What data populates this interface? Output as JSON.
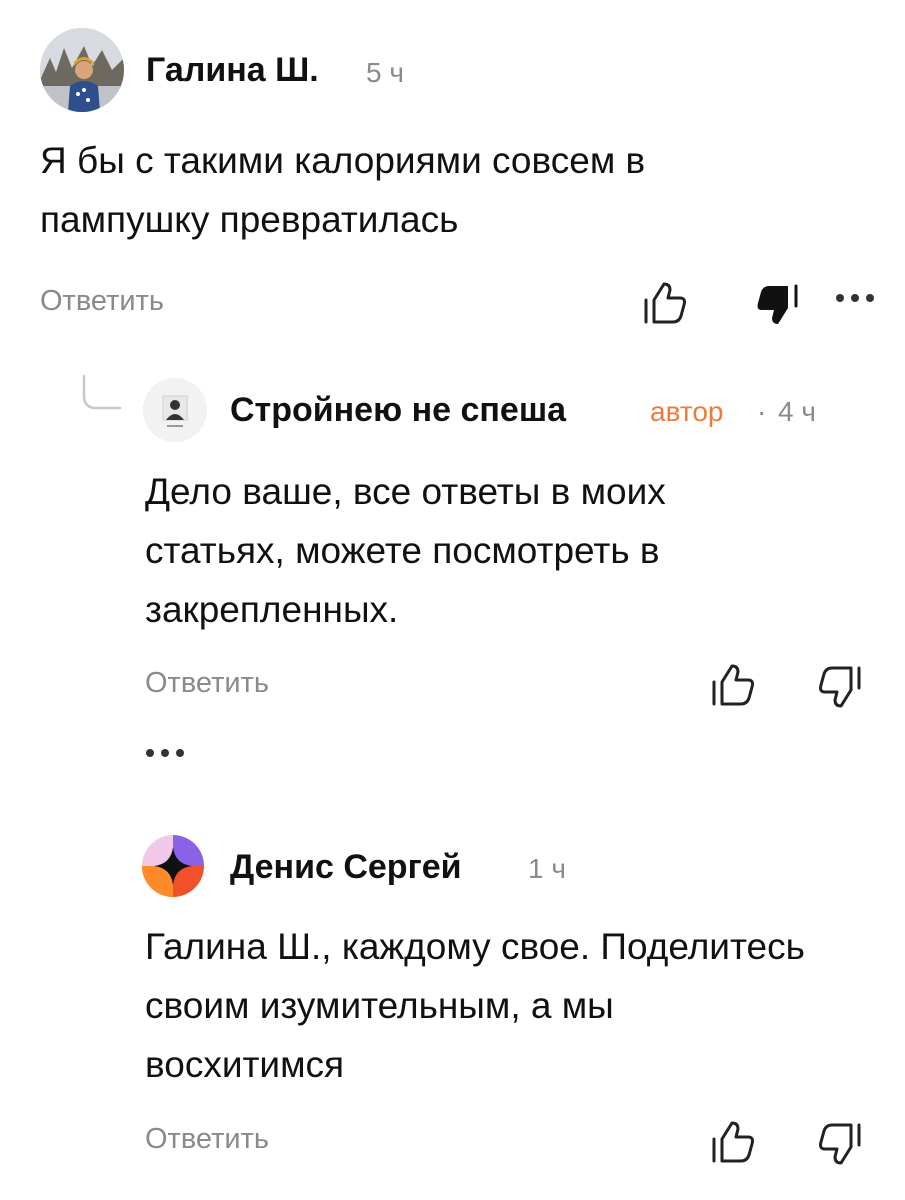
{
  "comments": [
    {
      "author": "Галина Ш.",
      "time": "5 ч",
      "text_lines": [
        "Я бы с такими калориями совсем в",
        "пампушку превратилась"
      ],
      "reply_label": "Ответить"
    },
    {
      "author": "Стройнею не спеша",
      "author_badge": "автор",
      "separator": "·",
      "time": "4 ч",
      "text_lines": [
        "Дело ваше, все ответы в моих",
        "статьях, можете посмотреть в",
        "закрепленных."
      ],
      "reply_label": "Ответить"
    },
    {
      "author": "Денис Сергей",
      "time": "1 ч",
      "text_lines": [
        "Галина Ш., каждому свое. Поделитесь",
        "своим изумительным, а мы",
        "восхитимся"
      ],
      "reply_label": "Ответить"
    }
  ],
  "icons": {
    "like": "thumbs-up-icon",
    "dislike": "thumbs-down-icon",
    "more": "more-dots-icon",
    "thread": "reply-thread-icon"
  },
  "colors": {
    "author_badge": "#f07a3c",
    "muted": "#8a8a8a",
    "text": "#111111"
  }
}
